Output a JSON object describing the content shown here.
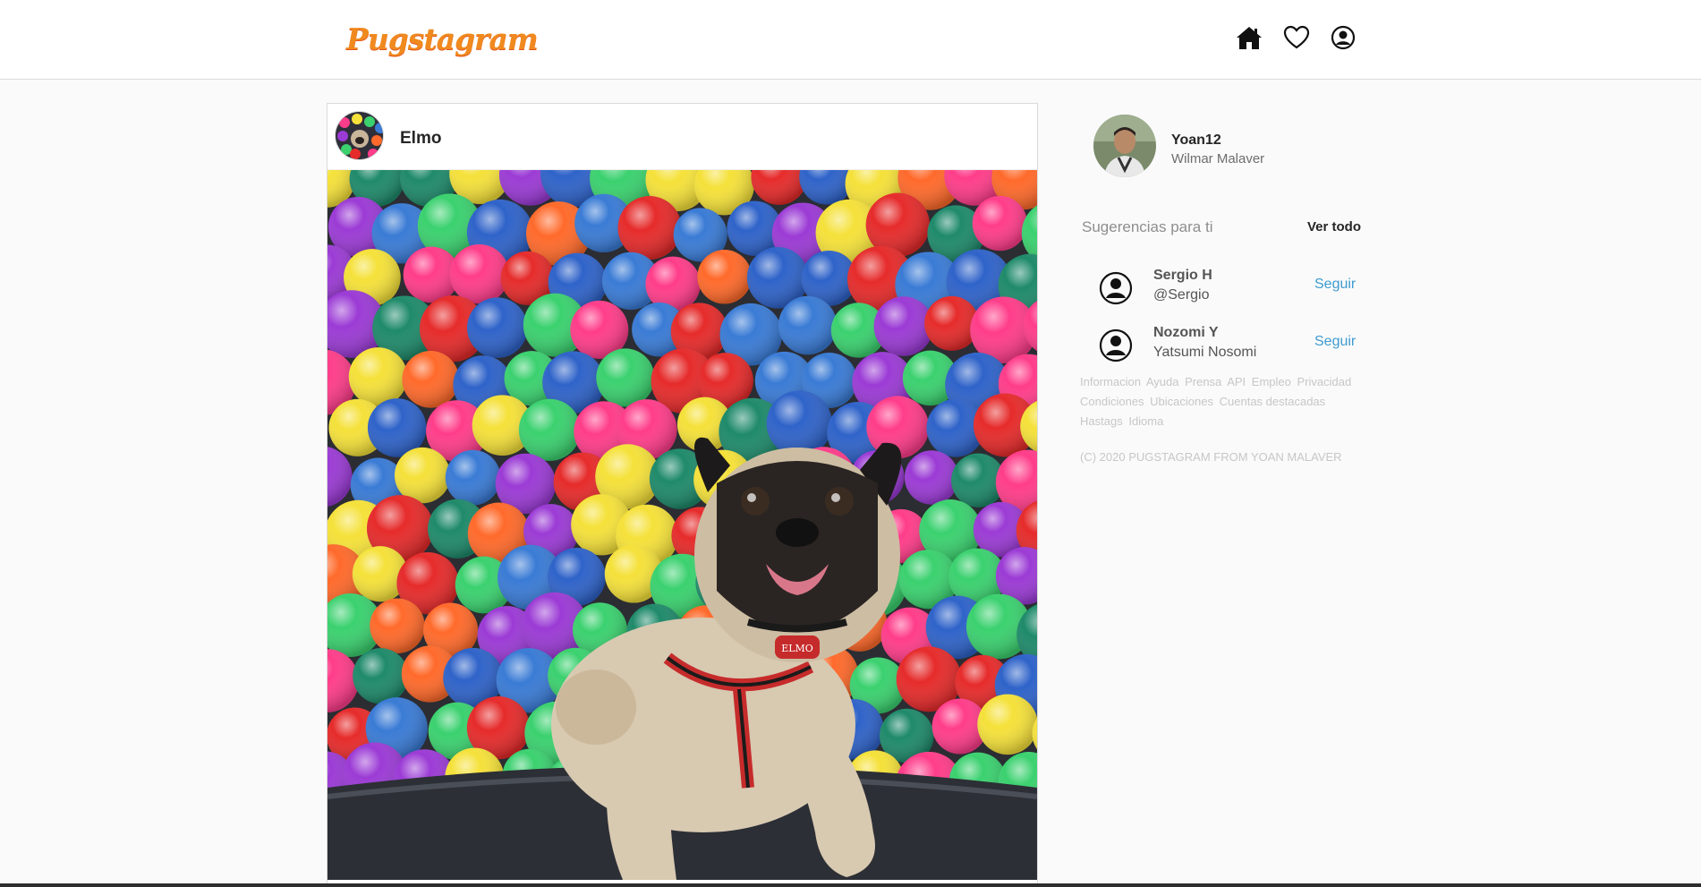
{
  "header": {
    "logo": "Pugstagram",
    "nav": [
      {
        "name": "home-icon"
      },
      {
        "name": "heart-icon"
      },
      {
        "name": "profile-icon"
      }
    ]
  },
  "post": {
    "username": "Elmo",
    "avatar_icon": "ball-pit-avatar",
    "image": "pug-in-ball-pit-photo",
    "collar_tag": "ELMO"
  },
  "sidebar": {
    "me": {
      "username": "Yoan12",
      "fullname": "Wilmar Malaver"
    },
    "suggestions_title": "Sugerencias para ti",
    "see_all": "Ver todo",
    "suggestions": [
      {
        "name": "Sergio H",
        "sub": "@Sergio",
        "action": "Seguir"
      },
      {
        "name": "Nozomi Y",
        "sub": "Yatsumi Nosomi",
        "action": "Seguir"
      }
    ],
    "footer_links": [
      "Informacion",
      "Ayuda",
      "Prensa",
      "API",
      "Empleo",
      "Privacidad",
      "Condiciones",
      "Ubicaciones",
      "Cuentas destacadas",
      "Hastags",
      "Idioma"
    ],
    "copyright": "(C) 2020 PUGSTAGRAM FROM YOAN MALAVER"
  },
  "colors": {
    "logo": "#f08a1f",
    "follow_link": "#3d9bd0",
    "background": "#fafafa"
  }
}
